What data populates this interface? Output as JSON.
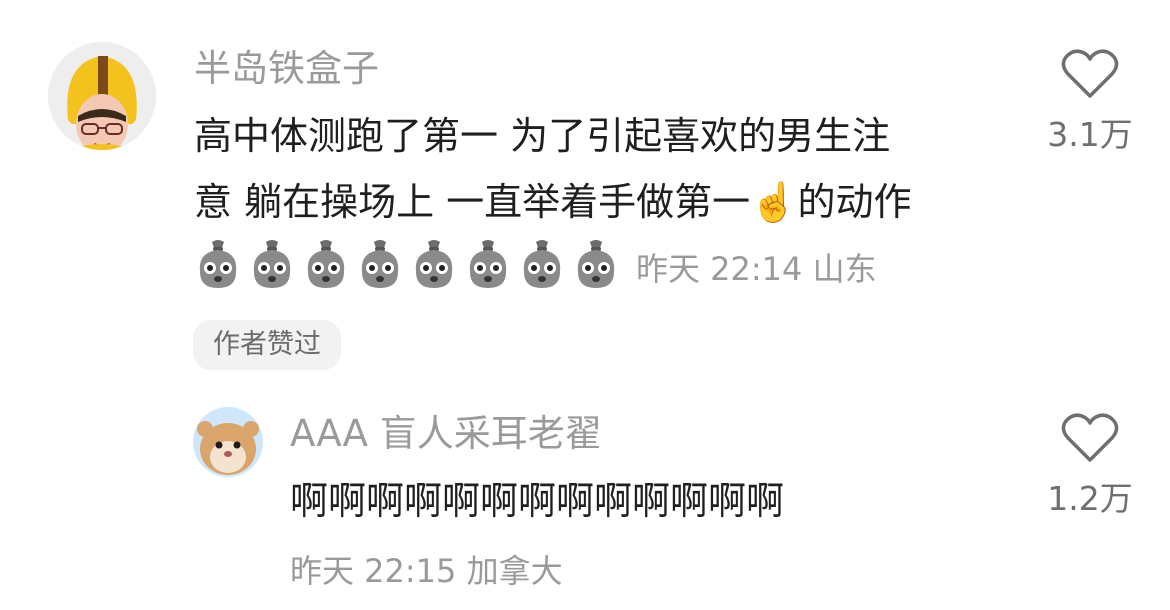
{
  "comments": [
    {
      "username": "半岛铁盒子",
      "text_line1": "高中体测跑了第一 为了引起喜欢的男生注",
      "text_line2_pre": "意 躺在操场上 一直举着手做第一",
      "text_line2_emoji": "☝️",
      "text_line2_post": "的动作",
      "emoji_row": {
        "icon": "money-bag-face-icon",
        "count": 8
      },
      "time": "昨天 22:14",
      "location": "山东",
      "author_badge": "作者赞过",
      "like_count": "3.1万"
    }
  ],
  "reply": {
    "username": "AAA 盲人采耳老翟",
    "text": "啊啊啊啊啊啊啊啊啊啊啊啊啊",
    "time": "昨天 22:15",
    "location": "加拿大",
    "like_count": "1.2万"
  },
  "colors": {
    "secondary_text": "#9a9a9a",
    "primary_text": "#1f1f1f",
    "badge_bg": "#f2f2f2"
  }
}
